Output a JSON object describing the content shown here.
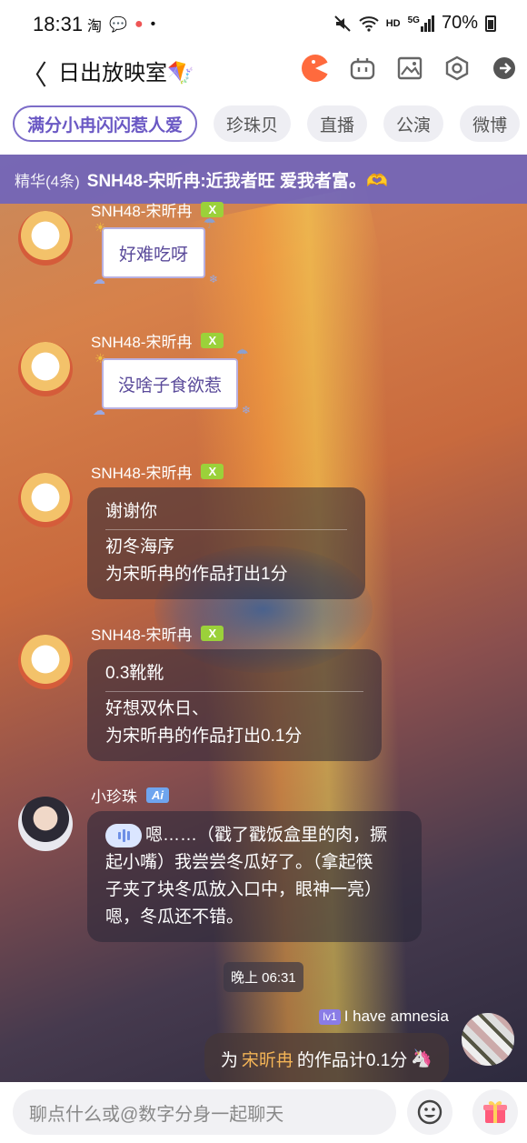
{
  "status_bar": {
    "time": "18:31",
    "left_icons": [
      "taobao-icon",
      "message-icon",
      "app-icon",
      "dot-icon"
    ],
    "left_glyphs": {
      "taobao": "淘",
      "message": "💬",
      "app": "●",
      "dot": "•"
    },
    "battery": "70%",
    "network": "HD",
    "signal": "5G"
  },
  "header": {
    "title": "日出放映室🪁",
    "back_glyph": "〈"
  },
  "tabs": [
    {
      "label": "满分小冉闪闪惹人爱",
      "active": true
    },
    {
      "label": "珍珠贝"
    },
    {
      "label": "直播"
    },
    {
      "label": "公演"
    },
    {
      "label": "微博"
    }
  ],
  "pinned": {
    "label": "精华(4条)",
    "text": "SNH48-宋昕冉:近我者旺 爱我者富。🫶"
  },
  "messages": [
    {
      "sender": "SNH48-宋昕冉",
      "badge": "X",
      "type": "sticker",
      "text": "好难吃呀"
    },
    {
      "sender": "SNH48-宋昕冉",
      "badge": "X",
      "type": "sticker",
      "text": "没啥子食欲惹"
    },
    {
      "sender": "SNH48-宋昕冉",
      "badge": "X",
      "type": "reply",
      "top": "谢谢你",
      "line1": "初冬海序",
      "line2": "为宋昕冉的作品打出1分"
    },
    {
      "sender": "SNH48-宋昕冉",
      "badge": "X",
      "type": "reply",
      "top": "0.3靴靴",
      "line1": "好想双休日、",
      "line2": "为宋昕冉的作品打出0.1分"
    },
    {
      "sender": "小珍珠",
      "badge": "Ai",
      "type": "ai",
      "line1": "嗯……（戳了戳饭盒里的肉，撅",
      "line2": "起小嘴）我尝尝冬瓜好了。（拿起筷",
      "line3": "子夹了块冬瓜放入口中，眼神一亮）",
      "line4": "嗯，冬瓜还不错。"
    }
  ],
  "timestamp": "晚上 06:31",
  "my_message": {
    "level": "lv1",
    "name": "I have amnesia",
    "prefix": "为",
    "highlight": "宋昕冉",
    "suffix": "的作品计0.1分",
    "tail_icon": "🦄"
  },
  "input": {
    "placeholder": "聊点什么或@数字分身一起聊天"
  },
  "colors": {
    "accent": "#6a58c4",
    "badge_x": "#9bd13a",
    "badge_ai": "#6fa5ef",
    "highlight": "#f2b356"
  }
}
